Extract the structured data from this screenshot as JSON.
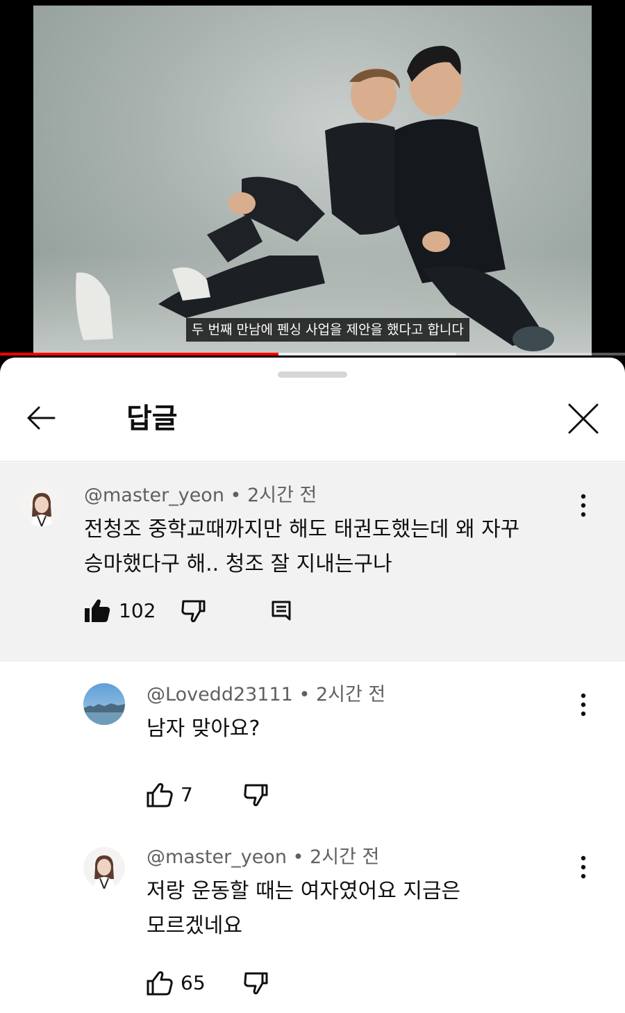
{
  "video": {
    "subtitle": "두 번째 만남에 펜싱 사업을 제안을 했다고 합니다",
    "progress": 0.445,
    "buffered": 0.73,
    "colors": {
      "played": "#ff0000"
    }
  },
  "sheet": {
    "title": "답글",
    "back_icon": "arrow-left-icon",
    "close_icon": "close-icon"
  },
  "comments": [
    {
      "author": "@master_yeon",
      "time": "2시간 전",
      "text_line1": "전청조 중학교때까지만 해도 태권도했는데 왜 자꾸",
      "text_line2": "승마했다구 해.. 청조 잘 지내는구나",
      "likes": "102",
      "liked": true,
      "avatar_icon": "profile-photo-woman"
    },
    {
      "author": "@Lovedd23111",
      "time": "2시간 전",
      "text_line1": "남자 맞아요?",
      "likes": "7",
      "liked": false,
      "avatar_icon": "profile-photo-landscape"
    },
    {
      "author": "@master_yeon",
      "time": "2시간 전",
      "text_line1": "저랑 운동할 때는 여자였어요 지금은",
      "text_line2": "모르겠네요",
      "likes": "65",
      "liked": false,
      "avatar_icon": "profile-photo-woman"
    }
  ],
  "separator": "•"
}
